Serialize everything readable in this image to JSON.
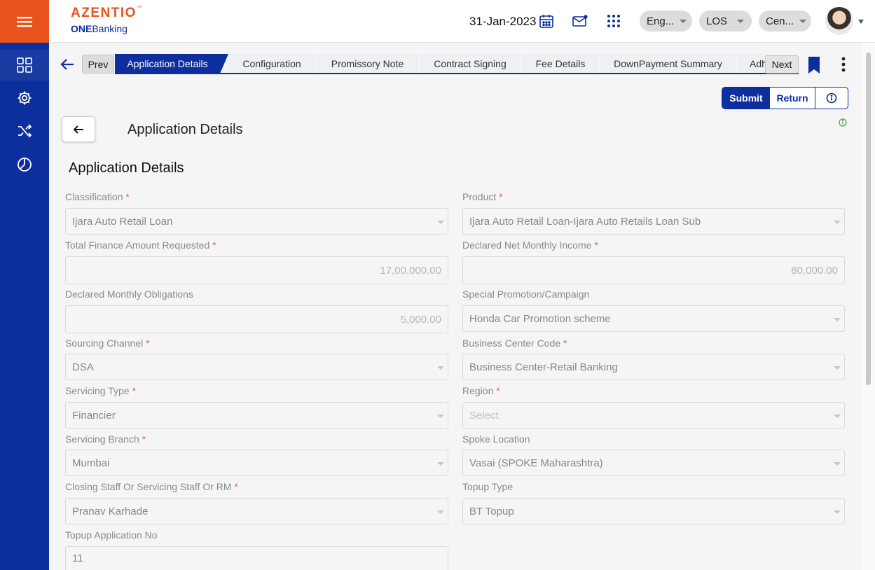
{
  "header": {
    "logo_brand": "AZENTIO",
    "logo_tm": "™",
    "logo_sub_bold": "ONE",
    "logo_sub_rest": "Banking",
    "date": "31-Jan-2023",
    "language": "Eng...",
    "module": "LOS",
    "center": "Cen..."
  },
  "sidebar": {
    "items": [
      {
        "icon": "menu-icon"
      },
      {
        "icon": "dashboard-grid-icon"
      },
      {
        "icon": "gear-icon"
      },
      {
        "icon": "shuffle-icon"
      },
      {
        "icon": "pie-chart-icon"
      }
    ]
  },
  "tabs": {
    "prev": "Prev",
    "next": "Next",
    "items": [
      {
        "label": "Application Details"
      },
      {
        "label": "Configuration"
      },
      {
        "label": "Promissory Note"
      },
      {
        "label": "Contract Signing"
      },
      {
        "label": "Fee Details"
      },
      {
        "label": "DownPayment Summary"
      },
      {
        "label": "Adh"
      }
    ]
  },
  "actions": {
    "submit": "Submit",
    "return": "Return"
  },
  "page": {
    "title": "Application Details",
    "section_title": "Application Details"
  },
  "form": {
    "classification": {
      "label": "Classification",
      "value": "Ijara Auto Retail Loan"
    },
    "product": {
      "label": "Product",
      "value": "Ijara Auto Retail Loan-Ijara Auto Retails Loan Sub"
    },
    "total_finance": {
      "label": "Total Finance Amount Requested",
      "value": "17,00,000.00"
    },
    "net_income": {
      "label": "Declared Net Monthly Income",
      "value": "80,000.00"
    },
    "monthly_obligations": {
      "label": "Declared Monthly Obligations",
      "value": "5,000.00"
    },
    "promotion": {
      "label": "Special Promotion/Campaign",
      "value": "Honda Car Promotion scheme"
    },
    "sourcing_channel": {
      "label": "Sourcing Channel",
      "value": "DSA"
    },
    "business_center": {
      "label": "Business Center Code",
      "value": "Business Center-Retail Banking"
    },
    "servicing_type": {
      "label": "Servicing Type",
      "value": "Financier"
    },
    "region": {
      "label": "Region",
      "placeholder": "Select"
    },
    "servicing_branch": {
      "label": "Servicing Branch",
      "value": "Mumbai"
    },
    "spoke_location": {
      "label": "Spoke Location",
      "value": "Vasai (SPOKE Maharashtra)"
    },
    "closing_staff": {
      "label": "Closing Staff Or Servicing Staff Or RM",
      "value": "Pranav Karhade"
    },
    "topup_type": {
      "label": "Topup Type",
      "value": "BT Topup"
    },
    "topup_app_no": {
      "label": "Topup Application No",
      "value": "11"
    }
  },
  "required_marker": "*",
  "colors": {
    "brand_blue": "#0d2f9e",
    "brand_orange": "#e8531d",
    "required": "#e26060"
  }
}
